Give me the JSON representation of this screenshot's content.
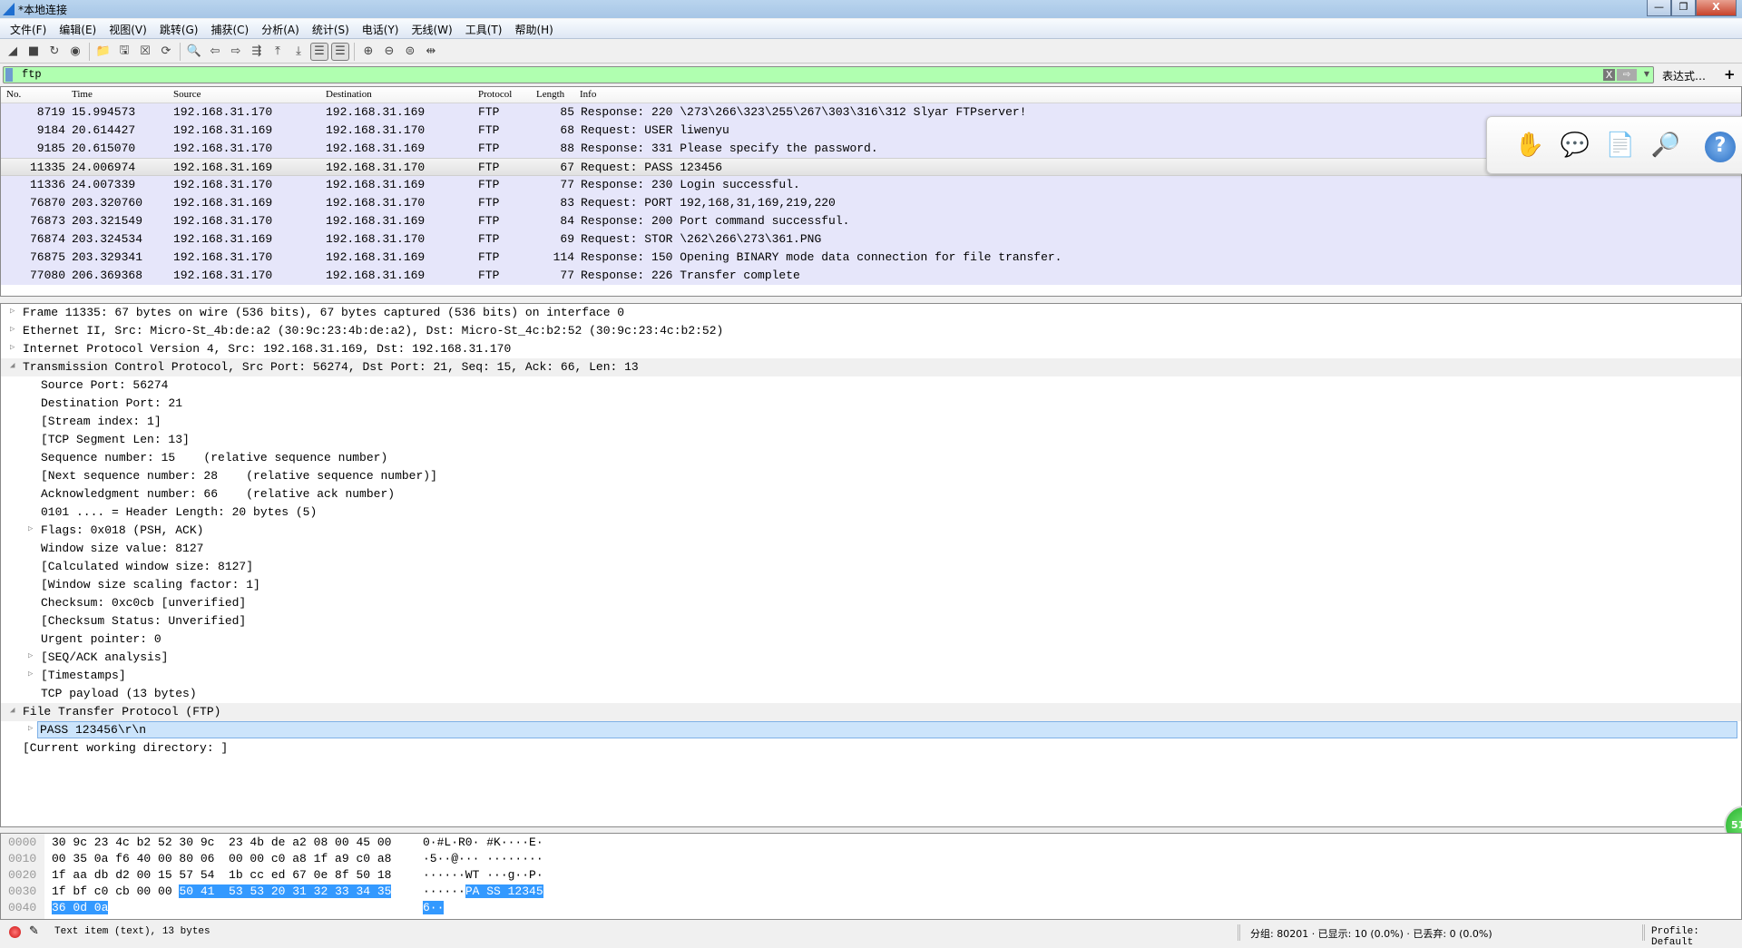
{
  "window": {
    "title": "*本地连接",
    "min": "—",
    "max": "❐",
    "close": "X"
  },
  "menu": [
    "文件(F)",
    "编辑(E)",
    "视图(V)",
    "跳转(G)",
    "捕获(C)",
    "分析(A)",
    "统计(S)",
    "电话(Y)",
    "无线(W)",
    "工具(T)",
    "帮助(H)"
  ],
  "toolbar": [
    {
      "icon": "shark-fin-start-icon",
      "g": "◢"
    },
    {
      "icon": "stop-icon",
      "g": "■"
    },
    {
      "icon": "restart-icon",
      "g": "↻"
    },
    {
      "icon": "capture-options-icon",
      "g": "◉"
    },
    {
      "sep": true
    },
    {
      "icon": "open-file-icon",
      "g": "📁"
    },
    {
      "icon": "save-file-icon",
      "g": "🖫"
    },
    {
      "icon": "close-file-icon",
      "g": "☒"
    },
    {
      "icon": "reload-icon",
      "g": "⟳"
    },
    {
      "sep": true
    },
    {
      "icon": "find-packet-icon",
      "g": "🔍"
    },
    {
      "icon": "go-back-icon",
      "g": "⇦"
    },
    {
      "icon": "go-forward-icon",
      "g": "⇨"
    },
    {
      "icon": "go-to-packet-icon",
      "g": "⇶"
    },
    {
      "icon": "go-first-icon",
      "g": "⤒"
    },
    {
      "icon": "go-last-icon",
      "g": "⤓"
    },
    {
      "icon": "auto-scroll-icon",
      "g": "☰",
      "active": true
    },
    {
      "icon": "colorize-icon",
      "g": "☰",
      "active": true
    },
    {
      "sep": true
    },
    {
      "icon": "zoom-in-icon",
      "g": "⊕"
    },
    {
      "icon": "zoom-out-icon",
      "g": "⊖"
    },
    {
      "icon": "zoom-normal-icon",
      "g": "⊜"
    },
    {
      "icon": "resize-columns-icon",
      "g": "⇹"
    }
  ],
  "filter": {
    "value": "ftp",
    "clear": "X",
    "apply": "⇨",
    "dropdown": "▼",
    "expression": "表达式…",
    "add": "+"
  },
  "columns": [
    "No.",
    "Time",
    "Source",
    "Destination",
    "Protocol",
    "Length",
    "Info"
  ],
  "packets": [
    {
      "no": "8719",
      "time": "15.994573",
      "src": "192.168.31.170",
      "dst": "192.168.31.169",
      "proto": "FTP",
      "len": "85",
      "info": "Response: 220 \\273\\266\\323\\255\\267\\303\\316\\312 Slyar FTPserver!"
    },
    {
      "no": "9184",
      "time": "20.614427",
      "src": "192.168.31.169",
      "dst": "192.168.31.170",
      "proto": "FTP",
      "len": "68",
      "info": "Request: USER liwenyu"
    },
    {
      "no": "9185",
      "time": "20.615070",
      "src": "192.168.31.170",
      "dst": "192.168.31.169",
      "proto": "FTP",
      "len": "88",
      "info": "Response: 331 Please specify the password."
    },
    {
      "no": "11335",
      "time": "24.006974",
      "src": "192.168.31.169",
      "dst": "192.168.31.170",
      "proto": "FTP",
      "len": "67",
      "info": "Request: PASS 123456",
      "selected": true
    },
    {
      "no": "11336",
      "time": "24.007339",
      "src": "192.168.31.170",
      "dst": "192.168.31.169",
      "proto": "FTP",
      "len": "77",
      "info": "Response: 230 Login successful."
    },
    {
      "no": "76870",
      "time": "203.320760",
      "src": "192.168.31.169",
      "dst": "192.168.31.170",
      "proto": "FTP",
      "len": "83",
      "info": "Request: PORT 192,168,31,169,219,220"
    },
    {
      "no": "76873",
      "time": "203.321549",
      "src": "192.168.31.170",
      "dst": "192.168.31.169",
      "proto": "FTP",
      "len": "84",
      "info": "Response: 200 Port command successful."
    },
    {
      "no": "76874",
      "time": "203.324534",
      "src": "192.168.31.169",
      "dst": "192.168.31.170",
      "proto": "FTP",
      "len": "69",
      "info": "Request: STOR \\262\\266\\273\\361.PNG"
    },
    {
      "no": "76875",
      "time": "203.329341",
      "src": "192.168.31.170",
      "dst": "192.168.31.169",
      "proto": "FTP",
      "len": "114",
      "info": "Response: 150 Opening BINARY mode data connection for file transfer."
    },
    {
      "no": "77080",
      "time": "206.369368",
      "src": "192.168.31.170",
      "dst": "192.168.31.169",
      "proto": "FTP",
      "len": "77",
      "info": "Response: 226 Transfer complete"
    }
  ],
  "overlay": [
    "hand-icon",
    "comment-icon",
    "export-icon",
    "search-doc-icon"
  ],
  "overlay_help": "?",
  "details": [
    {
      "d": 0,
      "a": "c",
      "t": "Frame 11335: 67 bytes on wire (536 bits), 67 bytes captured (536 bits) on interface 0"
    },
    {
      "d": 0,
      "a": "c",
      "t": "Ethernet II, Src: Micro-St_4b:de:a2 (30:9c:23:4b:de:a2), Dst: Micro-St_4c:b2:52 (30:9c:23:4c:b2:52)"
    },
    {
      "d": 0,
      "a": "c",
      "t": "Internet Protocol Version 4, Src: 192.168.31.169, Dst: 192.168.31.170"
    },
    {
      "d": 0,
      "a": "e",
      "t": "Transmission Control Protocol, Src Port: 56274, Dst Port: 21, Seq: 15, Ack: 66, Len: 13",
      "hl": true
    },
    {
      "d": 1,
      "t": "Source Port: 56274"
    },
    {
      "d": 1,
      "t": "Destination Port: 21"
    },
    {
      "d": 1,
      "t": "[Stream index: 1]"
    },
    {
      "d": 1,
      "t": "[TCP Segment Len: 13]"
    },
    {
      "d": 1,
      "t": "Sequence number: 15    (relative sequence number)"
    },
    {
      "d": 1,
      "t": "[Next sequence number: 28    (relative sequence number)]"
    },
    {
      "d": 1,
      "t": "Acknowledgment number: 66    (relative ack number)"
    },
    {
      "d": 1,
      "t": "0101 .... = Header Length: 20 bytes (5)"
    },
    {
      "d": 1,
      "a": "c",
      "t": "Flags: 0x018 (PSH, ACK)"
    },
    {
      "d": 1,
      "t": "Window size value: 8127"
    },
    {
      "d": 1,
      "t": "[Calculated window size: 8127]"
    },
    {
      "d": 1,
      "t": "[Window size scaling factor: 1]"
    },
    {
      "d": 1,
      "t": "Checksum: 0xc0cb [unverified]"
    },
    {
      "d": 1,
      "t": "[Checksum Status: Unverified]"
    },
    {
      "d": 1,
      "t": "Urgent pointer: 0"
    },
    {
      "d": 1,
      "a": "c",
      "t": "[SEQ/ACK analysis]"
    },
    {
      "d": 1,
      "a": "c",
      "t": "[Timestamps]"
    },
    {
      "d": 1,
      "t": "TCP payload (13 bytes)"
    },
    {
      "d": 0,
      "a": "e",
      "t": "File Transfer Protocol (FTP)",
      "hl": true
    },
    {
      "d": 1,
      "a": "c",
      "t": "PASS 123456\\r\\n",
      "sel": true
    },
    {
      "d": 0,
      "t": "[Current working directory: ]"
    }
  ],
  "bubble": "51",
  "bytes": [
    {
      "off": "0000",
      "hex": "30 9c 23 4c b2 52 30 9c  23 4b de a2 08 00 45 00",
      "hexsel": "",
      "ascii": "0·#L·R0· #K····E·",
      "asel": ""
    },
    {
      "off": "0010",
      "hex": "00 35 0a f6 40 00 80 06  00 00 c0 a8 1f a9 c0 a8",
      "hexsel": "",
      "ascii": "·5··@··· ········",
      "asel": ""
    },
    {
      "off": "0020",
      "hex": "1f aa db d2 00 15 57 54  1b cc ed 67 0e 8f 50 18",
      "hexsel": "",
      "ascii": "······WT ···g··P·",
      "asel": ""
    },
    {
      "off": "0030",
      "hex": "1f bf c0 cb 00 00 ",
      "hexsel": "50 41  53 53 20 31 32 33 34 35",
      "ascii": "······",
      "asel": "PA SS 12345"
    },
    {
      "off": "0040",
      "hex": "",
      "hexsel": "36 0d 0a",
      "ascii": "",
      "asel": "6··"
    }
  ],
  "status": {
    "item": "Text item (text), 13 bytes",
    "stats": "分组: 80201 · 已显示: 10 (0.0%) · 已丢弃: 0 (0.0%)",
    "profile": "Profile: Default"
  }
}
